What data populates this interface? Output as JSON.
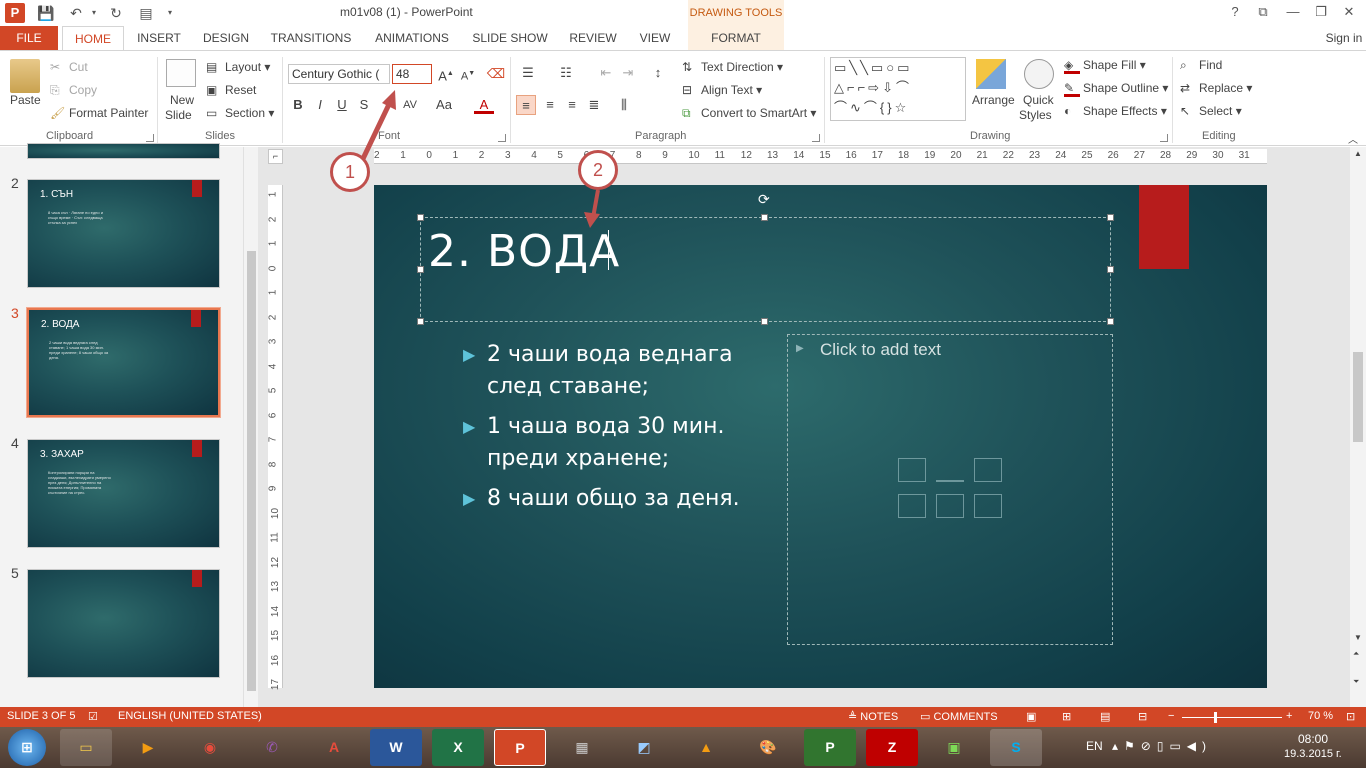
{
  "window": {
    "title": "m01v08 (1) - PowerPoint",
    "contextual_tab_group": "DRAWING TOOLS",
    "controls": [
      "?",
      "⧉",
      "—",
      "❐",
      "✕"
    ],
    "sign_in": "Sign in"
  },
  "tabs": [
    "FILE",
    "HOME",
    "INSERT",
    "DESIGN",
    "TRANSITIONS",
    "ANIMATIONS",
    "SLIDE SHOW",
    "REVIEW",
    "VIEW",
    "FORMAT"
  ],
  "ribbon": {
    "clipboard": {
      "label": "Clipboard",
      "paste": "Paste",
      "cut": "Cut",
      "copy": "Copy",
      "format_painter": "Format Painter"
    },
    "slides": {
      "label": "Slides",
      "new_slide_1": "New",
      "new_slide_2": "Slide",
      "layout": "Layout",
      "reset": "Reset",
      "section": "Section"
    },
    "font": {
      "label": "Font",
      "font_name": "Century Gothic (",
      "font_size": "48",
      "bold": "B",
      "italic": "I",
      "underline": "U",
      "shadow": "S",
      "char_spacing": "AV",
      "change_case": "Aa",
      "font_color": "A"
    },
    "paragraph": {
      "label": "Paragraph",
      "text_direction": "Text Direction",
      "align_text": "Align Text",
      "convert_smartart": "Convert to SmartArt"
    },
    "drawing": {
      "label": "Drawing",
      "arrange": "Arrange",
      "quick_styles_1": "Quick",
      "quick_styles_2": "Styles",
      "shape_fill": "Shape Fill",
      "shape_outline": "Shape Outline",
      "shape_effects": "Shape Effects"
    },
    "editing": {
      "label": "Editing",
      "find": "Find",
      "replace": "Replace",
      "select": "Select"
    }
  },
  "ruler": {
    "horizontal": [
      "2",
      "1",
      "0",
      "1",
      "2",
      "3",
      "4",
      "5",
      "6",
      "7",
      "8",
      "9",
      "10",
      "11",
      "12",
      "13",
      "14",
      "15",
      "16",
      "17",
      "18",
      "19",
      "20",
      "21",
      "22",
      "23",
      "24",
      "25",
      "26",
      "27",
      "28",
      "29",
      "30",
      "31"
    ],
    "vertical": [
      "1",
      "2",
      "1",
      "0",
      "1",
      "2",
      "3",
      "4",
      "5",
      "6",
      "7",
      "8",
      "9",
      "10",
      "11",
      "12",
      "13",
      "14",
      "15",
      "16",
      "17"
    ]
  },
  "thumbnails": [
    {
      "num": "2",
      "title": "1. СЪН",
      "lines": "8 часа сън · Лягане по едно и също време · Сън: следваща стъпка за успех"
    },
    {
      "num": "3",
      "title": "2. ВОДА",
      "lines": "2 чаши вода веднага след ставане; 1 чаша вода 30 мин. преди хранене; 8 чаши общо за деня."
    },
    {
      "num": "4",
      "title": "3. ЗАХАР",
      "lines": "Контролирани порции на сладкиши, въглехидрати умерено през деня; Допълнително на ниската енергия; Промяната състояние на стрес."
    },
    {
      "num": "5",
      "title": "",
      "lines": ""
    }
  ],
  "slide": {
    "title": "2. ВОДА",
    "bullets": [
      "2 чаши вода веднага след ставане;",
      "1 чаша вода 30 мин. преди хранене;",
      "8 чаши общо за деня."
    ],
    "placeholder": "Click to add text"
  },
  "callouts": [
    "1",
    "2"
  ],
  "status": {
    "slide_info": "SLIDE 3 OF 5",
    "language": "ENGLISH (UNITED STATES)",
    "notes": "NOTES",
    "comments": "COMMENTS",
    "zoom": "70 %"
  },
  "taskbar": {
    "lang": "EN",
    "time": "08:00",
    "date": "19.3.2015 г."
  },
  "colors": {
    "accent": "#d24726",
    "slide_bg": "#1f5259",
    "slide_red_tab": "#b71c1c",
    "callout": "#c0504d",
    "bullet": "#5ec3d9"
  }
}
